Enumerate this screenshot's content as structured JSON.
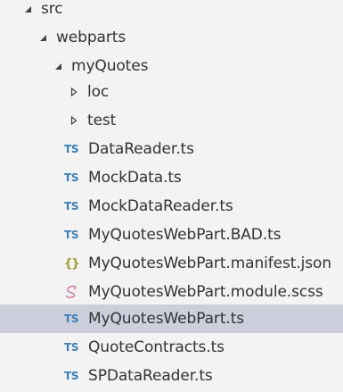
{
  "explorer": {
    "tree": [
      {
        "label": "src",
        "kind": "folder",
        "expanded": true,
        "depth": 0
      },
      {
        "label": "webparts",
        "kind": "folder",
        "expanded": true,
        "depth": 1
      },
      {
        "label": "myQuotes",
        "kind": "folder",
        "expanded": true,
        "depth": 2
      },
      {
        "label": "loc",
        "kind": "folder",
        "expanded": false,
        "depth": 3
      },
      {
        "label": "test",
        "kind": "folder",
        "expanded": false,
        "depth": 3
      },
      {
        "label": "DataReader.ts",
        "kind": "file",
        "icon": "TS",
        "depth": 3
      },
      {
        "label": "MockData.ts",
        "kind": "file",
        "icon": "TS",
        "depth": 3
      },
      {
        "label": "MockDataReader.ts",
        "kind": "file",
        "icon": "TS",
        "depth": 3
      },
      {
        "label": "MyQuotesWebPart.BAD.ts",
        "kind": "file",
        "icon": "TS",
        "depth": 3
      },
      {
        "label": "MyQuotesWebPart.manifest.json",
        "kind": "file",
        "icon": "{}",
        "depth": 3
      },
      {
        "label": "MyQuotesWebPart.module.scss",
        "kind": "file",
        "icon": "scss",
        "depth": 3
      },
      {
        "label": "MyQuotesWebPart.ts",
        "kind": "file",
        "icon": "TS",
        "depth": 3,
        "selected": true
      },
      {
        "label": "QuoteContracts.ts",
        "kind": "file",
        "icon": "TS",
        "depth": 3
      },
      {
        "label": "SPDataReader.ts",
        "kind": "file",
        "icon": "TS",
        "depth": 3
      }
    ],
    "colors": {
      "background": "#f3f3f3",
      "selection": "#cdcfdc",
      "ts_icon": "#3b7fb6",
      "json_icon": "#9a9d2d",
      "scss_icon": "#cd6799",
      "text": "#333333"
    }
  }
}
